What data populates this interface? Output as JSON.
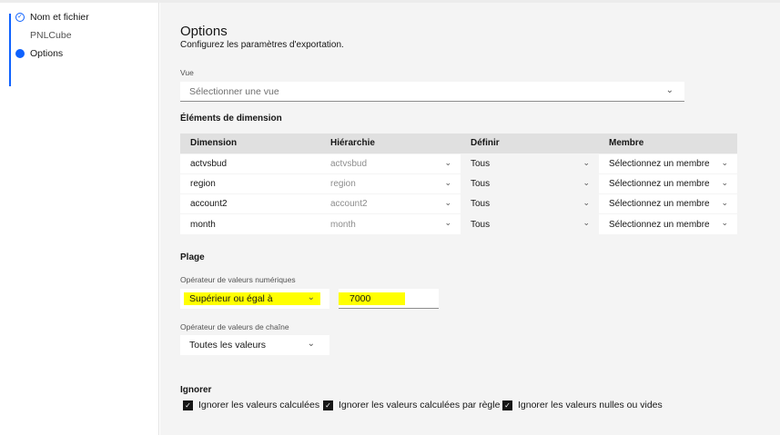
{
  "sidebar": {
    "steps": [
      {
        "label": "Nom et fichier",
        "state": "completed"
      },
      {
        "label": "PNLCube",
        "state": "sub"
      },
      {
        "label": "Options",
        "state": "current"
      }
    ]
  },
  "header": {
    "title": "Options",
    "subtitle": "Configurez les paramètres d'exportation."
  },
  "vue": {
    "label": "Vue",
    "placeholder": "Sélectionner une vue"
  },
  "dimensions": {
    "title": "Éléments de dimension",
    "columns": [
      "Dimension",
      "Hiérarchie",
      "Définir",
      "Membre"
    ],
    "rows": [
      {
        "dimension": "actvsbud",
        "hierarchy": "actvsbud",
        "set": "Tous",
        "member": "Sélectionnez un membre"
      },
      {
        "dimension": "region",
        "hierarchy": "region",
        "set": "Tous",
        "member": "Sélectionnez un membre"
      },
      {
        "dimension": "account2",
        "hierarchy": "account2",
        "set": "Tous",
        "member": "Sélectionnez un membre"
      },
      {
        "dimension": "month",
        "hierarchy": "month",
        "set": "Tous",
        "member": "Sélectionnez un membre"
      }
    ]
  },
  "plage": {
    "title": "Plage",
    "numeric_label": "Opérateur de valeurs numériques",
    "numeric_operator": "Supérieur ou égal à",
    "numeric_value": "7000",
    "string_label": "Opérateur de valeurs de chaîne",
    "string_operator": "Toutes les valeurs"
  },
  "ignorer": {
    "title": "Ignorer",
    "options": [
      {
        "label": "Ignorer les valeurs calculées",
        "checked": true
      },
      {
        "label": "Ignorer les valeurs calculées par règle",
        "checked": true
      },
      {
        "label": "Ignorer les valeurs nulles ou vides",
        "checked": true
      }
    ]
  },
  "colors": {
    "accent": "#0f62fe",
    "highlight": "#ffff00"
  }
}
